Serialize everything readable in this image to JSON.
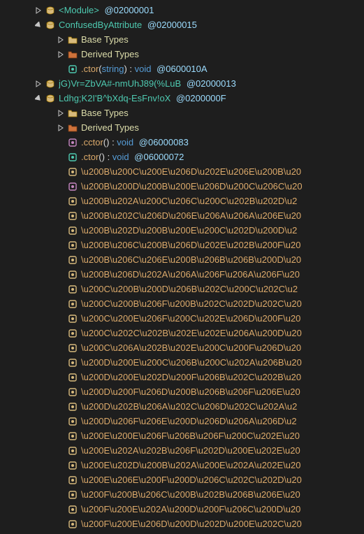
{
  "tree": [
    {
      "indent": 3,
      "expander": "closed",
      "icon": "namespace",
      "parts": [
        {
          "text": "<Module>",
          "cls": "name-ns"
        },
        {
          "text": " @02000001",
          "cls": "tok-meta"
        }
      ],
      "interact": true,
      "name": "module-node"
    },
    {
      "indent": 3,
      "expander": "open",
      "icon": "namespace",
      "parts": [
        {
          "text": "ConfusedByAttribute",
          "cls": "name-ns"
        },
        {
          "text": " @02000015",
          "cls": "tok-meta"
        }
      ],
      "interact": true,
      "name": "type-confusedbyattribute"
    },
    {
      "indent": 5,
      "expander": "closed",
      "icon": "folder",
      "parts": [
        {
          "text": "Base Types",
          "cls": "name-fld"
        }
      ],
      "interact": true,
      "name": "base-types-folder"
    },
    {
      "indent": 5,
      "expander": "closed",
      "icon": "folder-red",
      "parts": [
        {
          "text": "Derived Types",
          "cls": "name-fld"
        }
      ],
      "interact": true,
      "name": "derived-types-folder"
    },
    {
      "indent": 5,
      "expander": "none",
      "icon": "method-pub",
      "parts": [
        {
          "text": ".ctor",
          "cls": "name-member"
        },
        {
          "text": "(",
          "cls": "tok-punc"
        },
        {
          "text": "string",
          "cls": "tok-kw"
        },
        {
          "text": ") : ",
          "cls": "tok-punc"
        },
        {
          "text": "void",
          "cls": "tok-kw"
        },
        {
          "text": " @0600010A",
          "cls": "tok-meta"
        }
      ],
      "interact": true,
      "name": "ctor-method"
    },
    {
      "indent": 3,
      "expander": "closed",
      "icon": "namespace",
      "parts": [
        {
          "text": "jG)Vr=ZbVA#-nmUhJ89(%LuB",
          "cls": "name-ns"
        },
        {
          "text": " @02000013",
          "cls": "tok-meta"
        }
      ],
      "interact": true,
      "name": "type-obf1"
    },
    {
      "indent": 3,
      "expander": "open",
      "icon": "namespace",
      "parts": [
        {
          "text": "Ldhg;K2I'B^bXdq-EsFnv!oX",
          "cls": "name-ns"
        },
        {
          "text": " @0200000F",
          "cls": "tok-meta"
        }
      ],
      "interact": true,
      "name": "type-obf2"
    },
    {
      "indent": 5,
      "expander": "closed",
      "icon": "folder",
      "parts": [
        {
          "text": "Base Types",
          "cls": "name-fld"
        }
      ],
      "interact": true,
      "name": "base-types-folder-2"
    },
    {
      "indent": 5,
      "expander": "closed",
      "icon": "folder-red",
      "parts": [
        {
          "text": "Derived Types",
          "cls": "name-fld"
        }
      ],
      "interact": true,
      "name": "derived-types-folder-2"
    },
    {
      "indent": 5,
      "expander": "none",
      "icon": "method-priv",
      "parts": [
        {
          "text": ".cctor",
          "cls": "name-member"
        },
        {
          "text": "() : ",
          "cls": "tok-punc"
        },
        {
          "text": "void",
          "cls": "tok-kw"
        },
        {
          "text": " @06000083",
          "cls": "tok-meta"
        }
      ],
      "interact": true,
      "name": "cctor-method"
    },
    {
      "indent": 5,
      "expander": "none",
      "icon": "method-pub",
      "parts": [
        {
          "text": ".ctor",
          "cls": "name-member"
        },
        {
          "text": "() : ",
          "cls": "tok-punc"
        },
        {
          "text": "void",
          "cls": "tok-kw"
        },
        {
          "text": " @06000072",
          "cls": "tok-meta"
        }
      ],
      "interact": true,
      "name": "ctor-method-2"
    },
    {
      "indent": 5,
      "expander": "none",
      "icon": "method-int",
      "parts": [
        {
          "text": "\\u200B\\u200C\\u200E\\u206D\\u202E\\u206E\\u200B\\u20",
          "cls": "obf"
        }
      ],
      "interact": true,
      "name": "obf-member"
    },
    {
      "indent": 5,
      "expander": "none",
      "icon": "method-priv",
      "parts": [
        {
          "text": "\\u200B\\u200D\\u200B\\u200E\\u206D\\u200C\\u206C\\u20",
          "cls": "obf"
        }
      ],
      "interact": true,
      "name": "obf-member"
    },
    {
      "indent": 5,
      "expander": "none",
      "icon": "method-int",
      "parts": [
        {
          "text": "\\u200B\\u202A\\u200C\\u206C\\u200C\\u202B\\u202D\\u2",
          "cls": "obf"
        }
      ],
      "interact": true,
      "name": "obf-member"
    },
    {
      "indent": 5,
      "expander": "none",
      "icon": "method-int",
      "parts": [
        {
          "text": "\\u200B\\u202C\\u206D\\u206E\\u206A\\u206A\\u206E\\u20",
          "cls": "obf"
        }
      ],
      "interact": true,
      "name": "obf-member"
    },
    {
      "indent": 5,
      "expander": "none",
      "icon": "method-int",
      "parts": [
        {
          "text": "\\u200B\\u202D\\u200B\\u200E\\u200C\\u202D\\u200D\\u2",
          "cls": "obf"
        }
      ],
      "interact": true,
      "name": "obf-member"
    },
    {
      "indent": 5,
      "expander": "none",
      "icon": "method-int",
      "parts": [
        {
          "text": "\\u200B\\u206C\\u200B\\u206D\\u202E\\u202B\\u200F\\u20",
          "cls": "obf"
        }
      ],
      "interact": true,
      "name": "obf-member"
    },
    {
      "indent": 5,
      "expander": "none",
      "icon": "method-int",
      "parts": [
        {
          "text": "\\u200B\\u206C\\u206E\\u200B\\u206B\\u206B\\u200D\\u20",
          "cls": "obf"
        }
      ],
      "interact": true,
      "name": "obf-member"
    },
    {
      "indent": 5,
      "expander": "none",
      "icon": "method-int",
      "parts": [
        {
          "text": "\\u200B\\u206D\\u202A\\u206A\\u206F\\u206A\\u206F\\u20",
          "cls": "obf"
        }
      ],
      "interact": true,
      "name": "obf-member"
    },
    {
      "indent": 5,
      "expander": "none",
      "icon": "method-int",
      "parts": [
        {
          "text": "\\u200C\\u200B\\u200D\\u206B\\u202C\\u200C\\u202C\\u2",
          "cls": "obf"
        }
      ],
      "interact": true,
      "name": "obf-member"
    },
    {
      "indent": 5,
      "expander": "none",
      "icon": "method-int",
      "parts": [
        {
          "text": "\\u200C\\u200B\\u206F\\u200B\\u202C\\u202D\\u202C\\u20",
          "cls": "obf"
        }
      ],
      "interact": true,
      "name": "obf-member"
    },
    {
      "indent": 5,
      "expander": "none",
      "icon": "method-int",
      "parts": [
        {
          "text": "\\u200C\\u200E\\u206F\\u200C\\u202E\\u206D\\u200F\\u20",
          "cls": "obf"
        }
      ],
      "interact": true,
      "name": "obf-member"
    },
    {
      "indent": 5,
      "expander": "none",
      "icon": "method-int",
      "parts": [
        {
          "text": "\\u200C\\u202C\\u202B\\u202E\\u202E\\u206A\\u200D\\u20",
          "cls": "obf"
        }
      ],
      "interact": true,
      "name": "obf-member"
    },
    {
      "indent": 5,
      "expander": "none",
      "icon": "method-int",
      "parts": [
        {
          "text": "\\u200C\\u206A\\u202B\\u202E\\u200C\\u200F\\u206D\\u20",
          "cls": "obf"
        }
      ],
      "interact": true,
      "name": "obf-member"
    },
    {
      "indent": 5,
      "expander": "none",
      "icon": "method-int",
      "parts": [
        {
          "text": "\\u200D\\u200E\\u200C\\u206B\\u200C\\u202A\\u206B\\u20",
          "cls": "obf"
        }
      ],
      "interact": true,
      "name": "obf-member"
    },
    {
      "indent": 5,
      "expander": "none",
      "icon": "method-int",
      "parts": [
        {
          "text": "\\u200D\\u200E\\u202D\\u200F\\u206B\\u202C\\u202B\\u20",
          "cls": "obf"
        }
      ],
      "interact": true,
      "name": "obf-member"
    },
    {
      "indent": 5,
      "expander": "none",
      "icon": "method-int",
      "parts": [
        {
          "text": "\\u200D\\u200F\\u206D\\u200B\\u206B\\u206F\\u206E\\u20",
          "cls": "obf"
        }
      ],
      "interact": true,
      "name": "obf-member"
    },
    {
      "indent": 5,
      "expander": "none",
      "icon": "method-int",
      "parts": [
        {
          "text": "\\u200D\\u202B\\u206A\\u202C\\u206D\\u202C\\u202A\\u2",
          "cls": "obf"
        }
      ],
      "interact": true,
      "name": "obf-member"
    },
    {
      "indent": 5,
      "expander": "none",
      "icon": "method-int",
      "parts": [
        {
          "text": "\\u200D\\u206F\\u206E\\u200D\\u206D\\u206A\\u206D\\u2",
          "cls": "obf"
        }
      ],
      "interact": true,
      "name": "obf-member"
    },
    {
      "indent": 5,
      "expander": "none",
      "icon": "method-int",
      "parts": [
        {
          "text": "\\u200E\\u200E\\u206F\\u206B\\u206F\\u200C\\u202E\\u20",
          "cls": "obf"
        }
      ],
      "interact": true,
      "name": "obf-member"
    },
    {
      "indent": 5,
      "expander": "none",
      "icon": "method-int",
      "parts": [
        {
          "text": "\\u200E\\u202A\\u202B\\u206F\\u202D\\u200E\\u202E\\u20",
          "cls": "obf"
        }
      ],
      "interact": true,
      "name": "obf-member"
    },
    {
      "indent": 5,
      "expander": "none",
      "icon": "method-int",
      "parts": [
        {
          "text": "\\u200E\\u202D\\u200B\\u202A\\u200E\\u202A\\u202E\\u20",
          "cls": "obf"
        }
      ],
      "interact": true,
      "name": "obf-member"
    },
    {
      "indent": 5,
      "expander": "none",
      "icon": "method-int",
      "parts": [
        {
          "text": "\\u200E\\u206E\\u200F\\u200D\\u206C\\u202C\\u202D\\u20",
          "cls": "obf"
        }
      ],
      "interact": true,
      "name": "obf-member"
    },
    {
      "indent": 5,
      "expander": "none",
      "icon": "method-int",
      "parts": [
        {
          "text": "\\u200F\\u200B\\u206C\\u200B\\u202B\\u206B\\u206E\\u20",
          "cls": "obf"
        }
      ],
      "interact": true,
      "name": "obf-member"
    },
    {
      "indent": 5,
      "expander": "none",
      "icon": "method-int",
      "parts": [
        {
          "text": "\\u200F\\u200E\\u202A\\u200D\\u200F\\u206C\\u200D\\u20",
          "cls": "obf"
        }
      ],
      "interact": true,
      "name": "obf-member"
    },
    {
      "indent": 5,
      "expander": "none",
      "icon": "method-int",
      "parts": [
        {
          "text": "\\u200F\\u200E\\u206D\\u200D\\u202D\\u200E\\u202C\\u20",
          "cls": "obf"
        }
      ],
      "interact": true,
      "name": "obf-member"
    }
  ]
}
